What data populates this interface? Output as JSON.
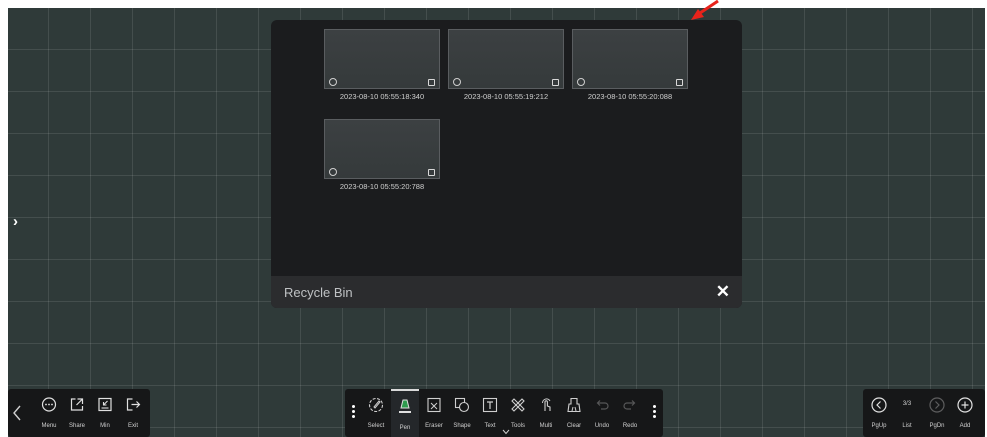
{
  "dialog": {
    "title": "Recycle Bin",
    "close_label": "✕",
    "items": [
      {
        "timestamp": "2023-08-10 05:55:18:340"
      },
      {
        "timestamp": "2023-08-10 05:55:19:212"
      },
      {
        "timestamp": "2023-08-10 05:55:20:088"
      },
      {
        "timestamp": "2023-08-10 05:55:20:788"
      }
    ]
  },
  "left_toolbar": {
    "items": [
      {
        "label": "Menu",
        "icon": "menu-circle-icon"
      },
      {
        "label": "Share",
        "icon": "share-icon"
      },
      {
        "label": "Min",
        "icon": "minimize-icon"
      },
      {
        "label": "Exit",
        "icon": "exit-icon"
      }
    ]
  },
  "center_toolbar": {
    "active_tool": "Pen",
    "items": [
      {
        "label": "Select",
        "icon": "select-icon"
      },
      {
        "label": "Pen",
        "icon": "pen-icon"
      },
      {
        "label": "Eraser",
        "icon": "eraser-icon"
      },
      {
        "label": "Shape",
        "icon": "shape-icon"
      },
      {
        "label": "Text",
        "icon": "text-icon"
      },
      {
        "label": "Tools",
        "icon": "tools-icon"
      },
      {
        "label": "Multi",
        "icon": "multi-touch-icon"
      },
      {
        "label": "Clear",
        "icon": "clear-icon"
      },
      {
        "label": "Undo",
        "icon": "undo-icon"
      },
      {
        "label": "Redo",
        "icon": "redo-icon"
      }
    ]
  },
  "right_toolbar": {
    "page_indicator": "3/3",
    "items": [
      {
        "label": "PgUp",
        "icon": "page-up-icon"
      },
      {
        "label": "List",
        "icon": "list-icon"
      },
      {
        "label": "PgDn",
        "icon": "page-down-icon"
      },
      {
        "label": "Add",
        "icon": "add-page-icon"
      }
    ]
  },
  "colors": {
    "canvas": "#2f3a39",
    "dialog_bg": "#1b1c1e",
    "toolbar_bg": "#161718",
    "annotation_arrow": "#e8231b"
  }
}
